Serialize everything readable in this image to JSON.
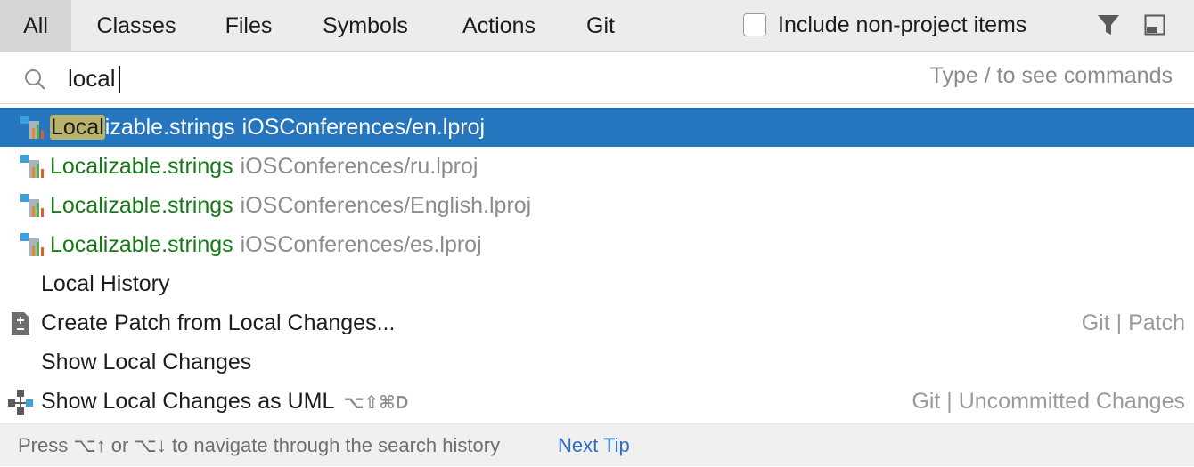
{
  "tabs": [
    {
      "label": "All",
      "active": true
    },
    {
      "label": "Classes"
    },
    {
      "label": "Files"
    },
    {
      "label": "Symbols"
    },
    {
      "label": "Actions"
    },
    {
      "label": "Git"
    }
  ],
  "include_non_project": {
    "label": "Include non-project items",
    "checked": false
  },
  "toolbar_icons": [
    "filter-icon",
    "pin-window-icon"
  ],
  "search": {
    "value": "local",
    "hint": "Type / to see commands",
    "icon": "search-icon"
  },
  "results": [
    {
      "highlight": "Local",
      "name_rest": "izable.strings",
      "name": "Localizable.strings",
      "path": "iOSConferences/en.lproj",
      "icon": "strings-file-icon",
      "selected": true
    },
    {
      "name": "Localizable.strings",
      "path": "iOSConferences/ru.lproj",
      "icon": "strings-file-icon"
    },
    {
      "name": "Localizable.strings",
      "path": "iOSConferences/English.lproj",
      "icon": "strings-file-icon"
    },
    {
      "name": "Localizable.strings",
      "path": "iOSConferences/es.lproj",
      "icon": "strings-file-icon"
    }
  ],
  "actions": [
    {
      "label": "Local History",
      "group": "",
      "shortcut": ""
    },
    {
      "label": "Create Patch from Local Changes...",
      "group": "Git | Patch",
      "shortcut": "",
      "icon": "patch-icon"
    },
    {
      "label": "Show Local Changes",
      "group": "",
      "shortcut": ""
    },
    {
      "label": "Show Local Changes as UML",
      "group": "Git | Uncommitted Changes",
      "shortcut": "⌥⇧⌘D",
      "icon": "uml-diagram-icon"
    }
  ],
  "footer": {
    "text": "Press ⌥↑ or ⌥↓ to navigate through the search history",
    "next_tip": "Next Tip"
  },
  "colors": {
    "selection": "#2675bf",
    "file_name": "#167a16",
    "match_highlight": "#b8b36b",
    "link": "#2e6fc2"
  }
}
